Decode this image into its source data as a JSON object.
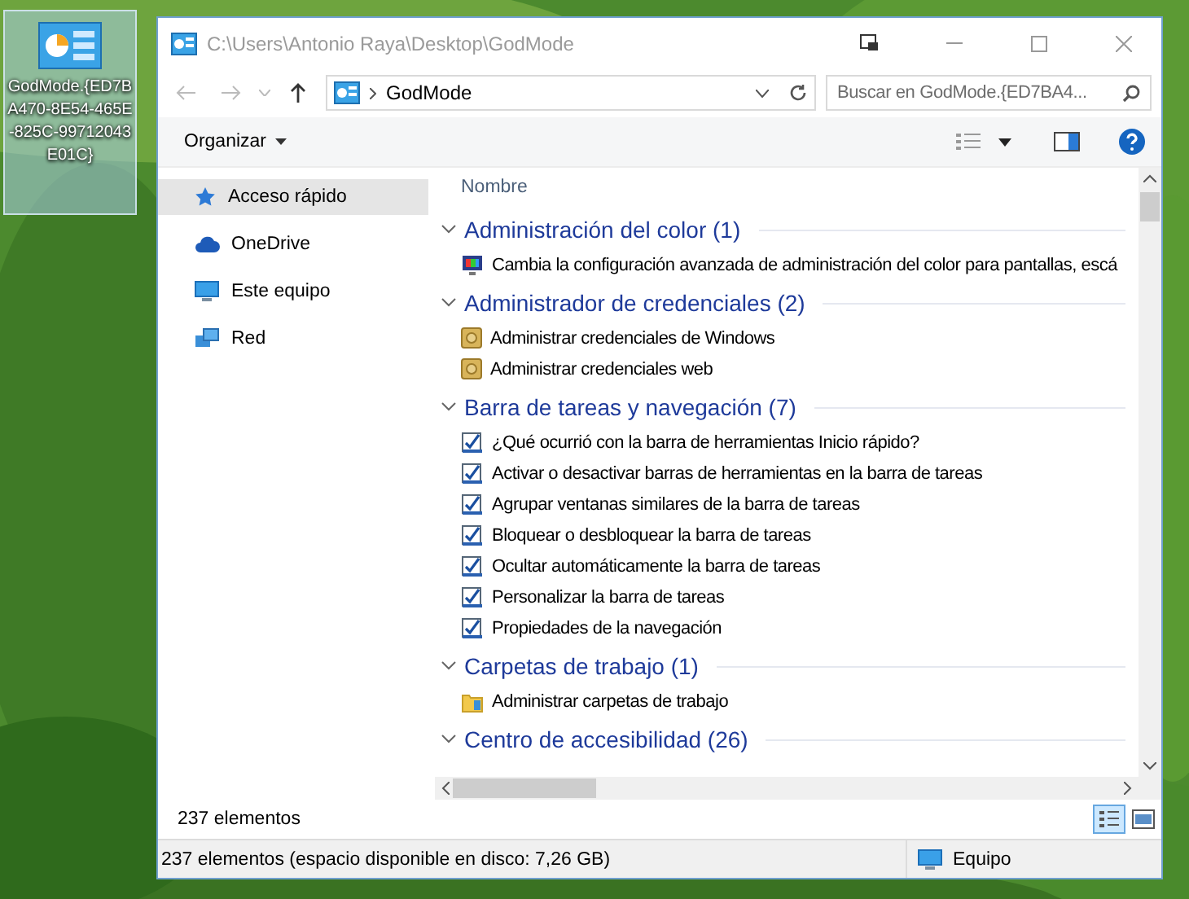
{
  "desktop_icon": {
    "label": "GodMode.{ED7BA470-8E54-465E-825C-99712043E01C}",
    "selected": true
  },
  "window": {
    "title": "C:\\Users\\Antonio Raya\\Desktop\\GodMode"
  },
  "address_bar": {
    "path": "GodMode"
  },
  "search": {
    "placeholder": "Buscar en GodMode.{ED7BA4..."
  },
  "toolbar": {
    "organize": "Organizar"
  },
  "sidebar": {
    "items": [
      {
        "label": "Acceso rápido",
        "kind": "star",
        "selected": true
      },
      {
        "label": "OneDrive",
        "kind": "cloud",
        "selected": false
      },
      {
        "label": "Este equipo",
        "kind": "pc",
        "selected": false
      },
      {
        "label": "Red",
        "kind": "network",
        "selected": false
      }
    ]
  },
  "column_header": "Nombre",
  "groups": [
    {
      "title": "Administración del color (1)",
      "expanded": true,
      "items": [
        {
          "kind": "color",
          "label": "Cambia la configuración avanzada de administración del color para pantallas, escá"
        }
      ]
    },
    {
      "title": "Administrador de credenciales (2)",
      "expanded": true,
      "items": [
        {
          "kind": "credential",
          "label": "Administrar credenciales de Windows"
        },
        {
          "kind": "credential",
          "label": "Administrar credenciales web"
        }
      ]
    },
    {
      "title": "Barra de tareas y navegación (7)",
      "expanded": true,
      "items": [
        {
          "kind": "taskbar",
          "label": "¿Qué ocurrió con la barra de herramientas Inicio rápido?"
        },
        {
          "kind": "taskbar",
          "label": "Activar o desactivar barras de herramientas en la barra de tareas"
        },
        {
          "kind": "taskbar",
          "label": "Agrupar ventanas similares de la barra de tareas"
        },
        {
          "kind": "taskbar",
          "label": "Bloquear o desbloquear la barra de tareas"
        },
        {
          "kind": "taskbar",
          "label": "Ocultar automáticamente la barra de tareas"
        },
        {
          "kind": "taskbar",
          "label": "Personalizar la barra de tareas"
        },
        {
          "kind": "taskbar",
          "label": "Propiedades de la navegación"
        }
      ]
    },
    {
      "title": "Carpetas de trabajo (1)",
      "expanded": true,
      "items": [
        {
          "kind": "folder",
          "label": "Administrar carpetas de trabajo"
        }
      ]
    },
    {
      "title": "Centro de accesibilidad (26)",
      "expanded": true
    }
  ],
  "item_count": "237 elementos",
  "status_bar": {
    "text": "237 elementos (espacio disponible en disco: 7,26 GB)",
    "location": "Equipo"
  }
}
